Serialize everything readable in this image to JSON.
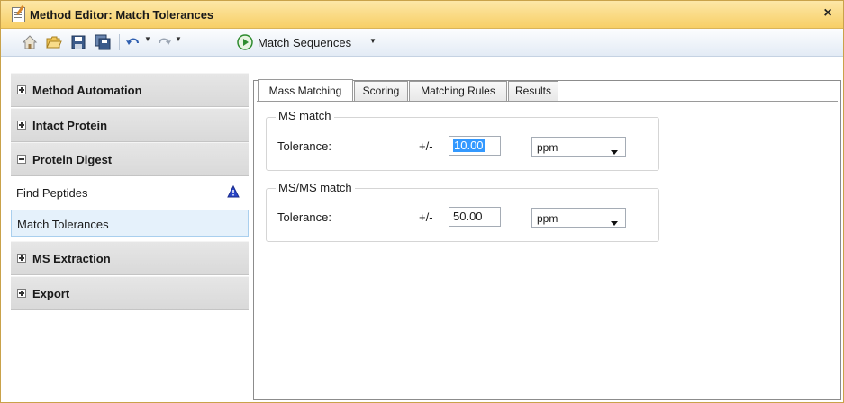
{
  "window": {
    "title": "Method Editor: Match Tolerances",
    "close_label": "×"
  },
  "toolbar": {
    "icons": [
      "home-icon",
      "open-folder-icon",
      "save-icon",
      "save-as-icon",
      "undo-icon",
      "redo-icon",
      "run-icon"
    ],
    "run_label": "Match Sequences"
  },
  "sidebar": {
    "sections": [
      {
        "label": "Method Automation",
        "expanded": false
      },
      {
        "label": "Intact Protein",
        "expanded": false
      },
      {
        "label": "Protein Digest",
        "expanded": true
      },
      {
        "label": "MS Extraction",
        "expanded": false
      },
      {
        "label": "Export",
        "expanded": false
      }
    ],
    "items": [
      {
        "label": "Find Peptides",
        "icon": "warning-icon"
      },
      {
        "label": "Match Tolerances",
        "selected": true
      }
    ]
  },
  "tabs": [
    "Mass Matching",
    "Scoring",
    "Matching Rules",
    "Results"
  ],
  "active_tab": "Mass Matching",
  "ms_match": {
    "title": "MS match",
    "label": "Tolerance:",
    "plus_minus": "+/-",
    "value": "10.00",
    "unit": "ppm"
  },
  "msms_match": {
    "title": "MS/MS match",
    "label": "Tolerance:",
    "plus_minus": "+/-",
    "value": "50.00",
    "unit": "ppm"
  },
  "colors": {
    "title_bar": "#f7cf66",
    "selection": "#3399ff",
    "selected_item": "#e5f1fb"
  }
}
